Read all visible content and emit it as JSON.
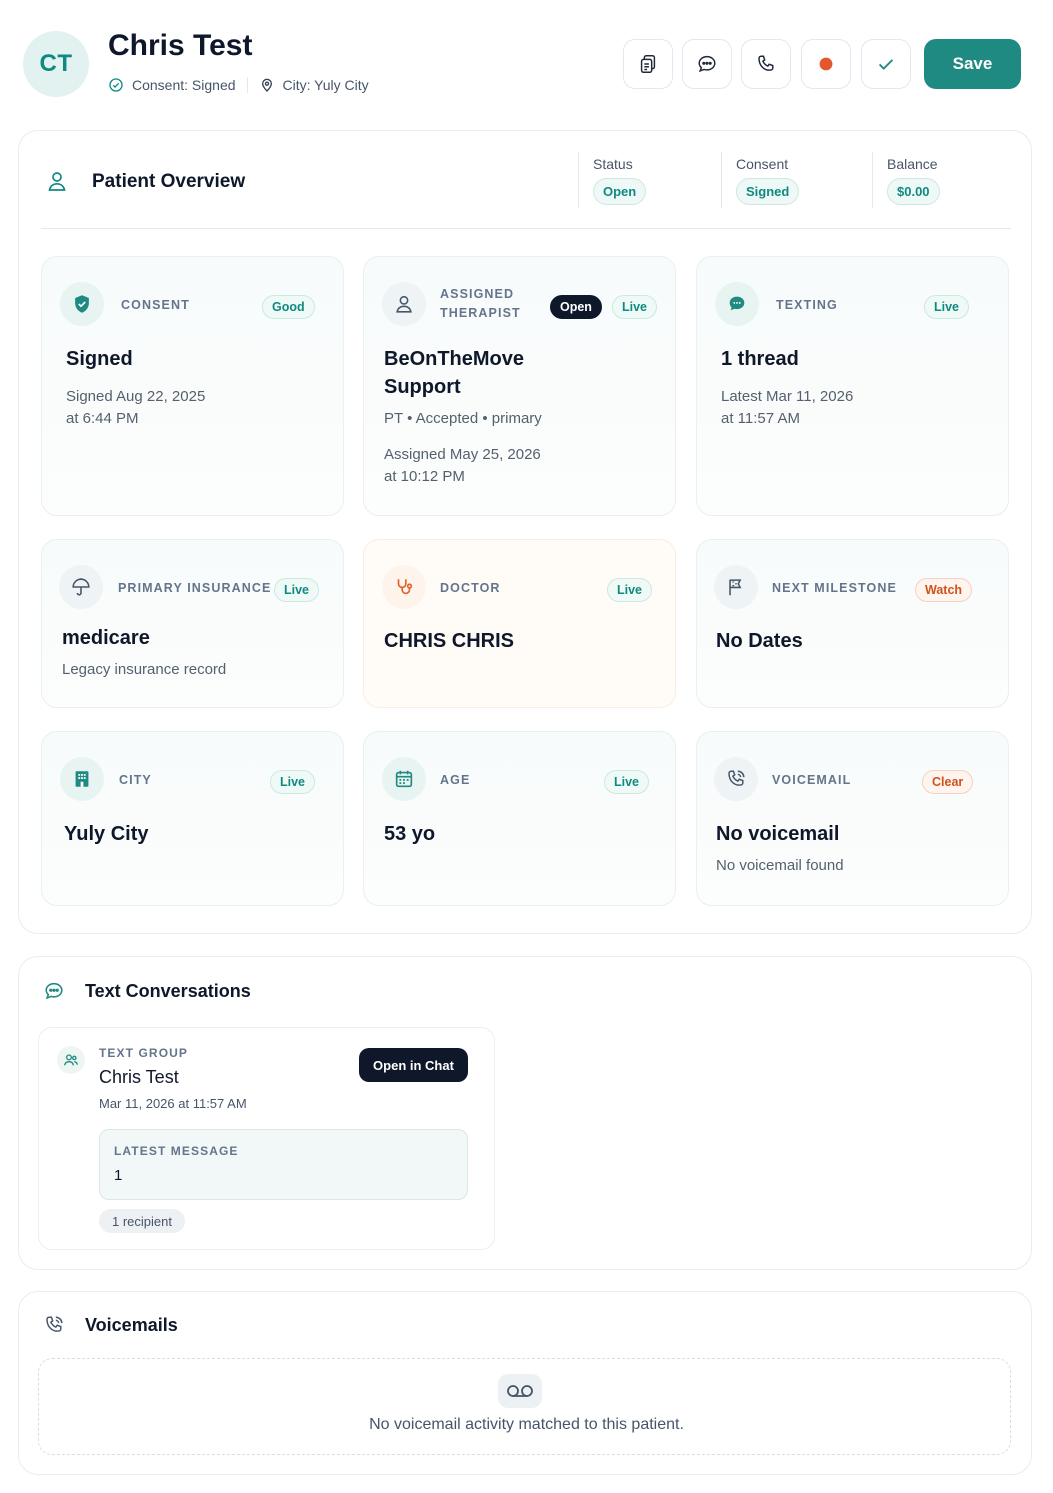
{
  "header": {
    "initials": "CT",
    "name": "Chris Test",
    "consent_label": "Consent: Signed",
    "city_label": "City: Yuly City",
    "save_label": "Save"
  },
  "overview": {
    "title": "Patient Overview",
    "stats": [
      {
        "label": "Status",
        "value": "Open"
      },
      {
        "label": "Consent",
        "value": "Signed"
      },
      {
        "label": "Balance",
        "value": "$0.00"
      }
    ],
    "cards": {
      "consent": {
        "label": "CONSENT",
        "tag": "Good",
        "value": "Signed",
        "sub1": "Signed Aug 22, 2025",
        "sub2": "at 6:44 PM"
      },
      "therapist": {
        "label1": "ASSIGNED",
        "label2": "THERAPIST",
        "tag_open": "Open",
        "tag_live": "Live",
        "value1": "BeOnTheMove",
        "value2": "Support",
        "detail": "PT • Accepted • primary",
        "sub1": "Assigned May 25, 2026",
        "sub2": "at 10:12 PM"
      },
      "texting": {
        "label": "TEXTING",
        "tag": "Live",
        "value": "1 thread",
        "sub1": "Latest Mar 11, 2026",
        "sub2": "at 11:57 AM"
      },
      "insurance": {
        "label": "PRIMARY INSURANCE",
        "tag": "Live",
        "value": "medicare",
        "sub1": "Legacy insurance record"
      },
      "doctor": {
        "label": "DOCTOR",
        "tag": "Live",
        "value": "CHRIS CHRIS"
      },
      "milestone": {
        "label": "NEXT MILESTONE",
        "tag": "Watch",
        "value": "No Dates"
      },
      "city": {
        "label": "CITY",
        "tag": "Live",
        "value": "Yuly City"
      },
      "age": {
        "label": "AGE",
        "tag": "Live",
        "value": "53 yo"
      },
      "voicemail": {
        "label": "VOICEMAIL",
        "tag": "Clear",
        "value": "No voicemail",
        "sub1": "No voicemail found"
      }
    }
  },
  "text_conversations": {
    "title": "Text Conversations",
    "thread": {
      "kind": "TEXT GROUP",
      "name": "Chris Test",
      "date": "Mar 11, 2026 at 11:57 AM",
      "open_label": "Open in Chat",
      "latest_label": "LATEST MESSAGE",
      "latest_value": "1",
      "recipients": "1 recipient"
    }
  },
  "voicemails": {
    "title": "Voicemails",
    "empty_message": "No voicemail activity matched to this patient."
  },
  "colors": {
    "accent": "#1f8a82",
    "dark": "#0f172a",
    "record_dot": "#e4572e",
    "warning": "#d0531b"
  },
  "icons": [
    "check-circle-icon",
    "map-pin-icon",
    "clipboard-copy-icon",
    "chat-bubble-icon",
    "phone-icon",
    "record-icon",
    "check-icon",
    "user-icon",
    "shield-check-icon",
    "message-icon",
    "umbrella-icon",
    "stethoscope-icon",
    "flag-icon",
    "building-icon",
    "calendar-icon",
    "phone-call-icon",
    "users-icon",
    "voicemail-icon"
  ]
}
